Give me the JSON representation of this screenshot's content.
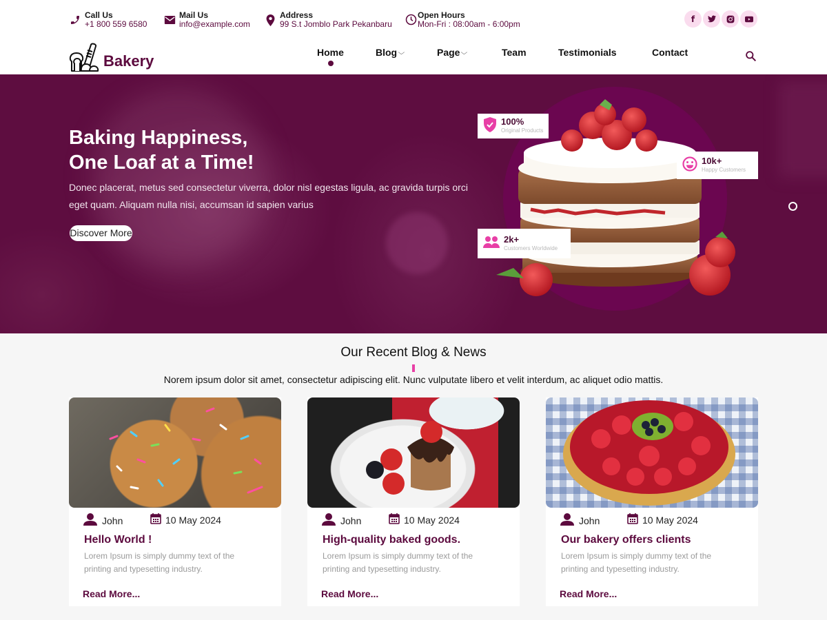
{
  "topbar": {
    "contacts": [
      {
        "icon": "phone-icon",
        "label": "Call Us",
        "value": "+1 800 559 6580"
      },
      {
        "icon": "mail-icon",
        "label": "Mail Us",
        "value": "info@example.com"
      },
      {
        "icon": "location-pin-icon",
        "label": "Address",
        "value": "99 S.t Jomblo Park Pekanbaru"
      },
      {
        "icon": "clock-icon",
        "label": "Open Hours",
        "value": "Mon-Fri : 08:00am - 6:00pm"
      }
    ],
    "social": [
      {
        "icon": "facebook-icon",
        "glyph": "f"
      },
      {
        "icon": "twitter-icon",
        "glyph": "t"
      },
      {
        "icon": "instagram-icon",
        "glyph": "◙"
      },
      {
        "icon": "youtube-icon",
        "glyph": "▶"
      }
    ]
  },
  "brand": {
    "name": "Bakery",
    "accent": "#5c0a3e",
    "pink": "#e83fa6"
  },
  "nav": {
    "items": [
      {
        "label": "Home",
        "active": true,
        "dropdown": false
      },
      {
        "label": "Blog",
        "active": false,
        "dropdown": true
      },
      {
        "label": "Page",
        "active": false,
        "dropdown": true
      },
      {
        "label": "Team",
        "active": false,
        "dropdown": false
      },
      {
        "label": "Testimonials",
        "active": false,
        "dropdown": false
      },
      {
        "label": "Contact",
        "active": false,
        "dropdown": false
      }
    ],
    "chevron": "⌵"
  },
  "hero": {
    "title_line1": "Baking Happiness,",
    "title_line2": "One Loaf at a Time!",
    "description": "Donec placerat, metus sed consectetur viverra, dolor nisl egestas ligula, ac gravida turpis orci eget quam. Aliquam nulla nisi, accumsan id sapien varius",
    "cta": "Discover More",
    "stats": [
      {
        "value": "100%",
        "label": "Original Products",
        "icon": "shield-check-icon"
      },
      {
        "value": "10k+",
        "label": "Happy Customers",
        "icon": "smiley-icon"
      },
      {
        "value": "2k+",
        "label": "Customers Worldwide",
        "icon": "users-icon"
      }
    ]
  },
  "blog": {
    "title": "Our Recent Blog & News",
    "subtitle": "Norem ipsum dolor sit amet, consectetur adipiscing elit. Nunc vulputate libero et velit interdum, ac aliquet odio mattis.",
    "posts": [
      {
        "author": "John",
        "date": "10 May 2024",
        "title": "Hello World !",
        "excerpt": "Lorem Ipsum is simply dummy text of  the printing and typesetting industry.",
        "read_more": "Read More...",
        "image": "sprinkle-muffins"
      },
      {
        "author": "John",
        "date": "10 May 2024",
        "title": "High-quality baked goods.",
        "excerpt": "Lorem Ipsum is simply dummy text of  the printing and typesetting industry.",
        "read_more": "Read More...",
        "image": "chocolate-muffin-berries"
      },
      {
        "author": "John",
        "date": "10 May 2024",
        "title": "Our bakery offers clients",
        "excerpt": "Lorem Ipsum is simply dummy text of  the printing and typesetting industry.",
        "read_more": "Read More...",
        "image": "fruit-tart"
      }
    ]
  }
}
